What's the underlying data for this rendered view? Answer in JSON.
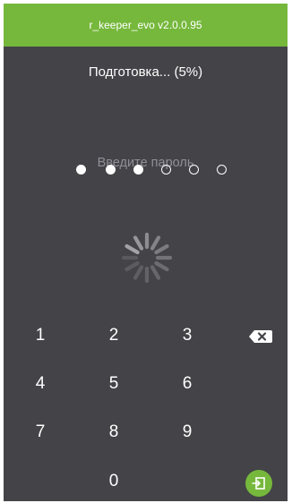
{
  "header": {
    "title": "r_keeper_evo v2.0.0.95"
  },
  "status_text": "Подготовка... (5%)",
  "progress_percent": 5,
  "pin": {
    "prompt": "Введите пароль",
    "length": 6,
    "entered": 3
  },
  "keypad": {
    "keys": [
      "1",
      "2",
      "3",
      "4",
      "5",
      "6",
      "7",
      "8",
      "9",
      "0"
    ],
    "backspace_icon": "backspace-icon",
    "enter_icon": "enter-login-icon"
  },
  "colors": {
    "accent": "#76b83c",
    "background": "#434348",
    "prompt_text": "#8f8f96"
  },
  "loading_icon": "spinner-icon"
}
